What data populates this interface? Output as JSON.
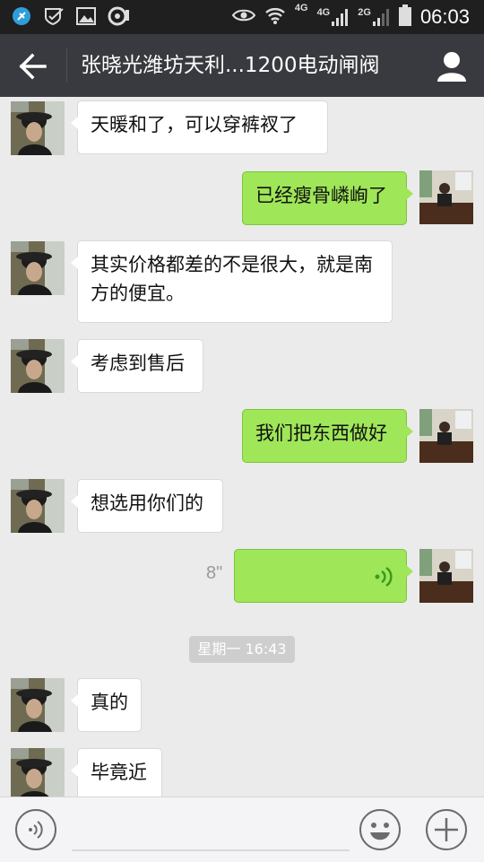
{
  "status_bar": {
    "network_labels": [
      "4G",
      "4G",
      "2G"
    ],
    "time": "06:03"
  },
  "header": {
    "title": "张晓光潍坊天利...1200电动闸阀"
  },
  "messages": [
    {
      "side": "left",
      "text": "天暖和了，可以穿裤衩了"
    },
    {
      "side": "right",
      "text": "已经瘦骨嶙峋了"
    },
    {
      "side": "left",
      "text": "其实价格都差的不是很大，就是南方的便宜。"
    },
    {
      "side": "left",
      "text": "考虑到售后"
    },
    {
      "side": "right",
      "text": "我们把东西做好"
    },
    {
      "side": "left",
      "text": "想选用你们的"
    },
    {
      "side": "right",
      "type": "voice",
      "duration": "8\""
    },
    {
      "type": "timestamp",
      "text": "星期一 16:43"
    },
    {
      "side": "left",
      "text": "真的"
    },
    {
      "side": "left",
      "text": "毕竟近"
    }
  ],
  "colors": {
    "title_bar": "#393a3f",
    "sent_bubble": "#9fe658",
    "chat_bg": "#ebebeb"
  }
}
